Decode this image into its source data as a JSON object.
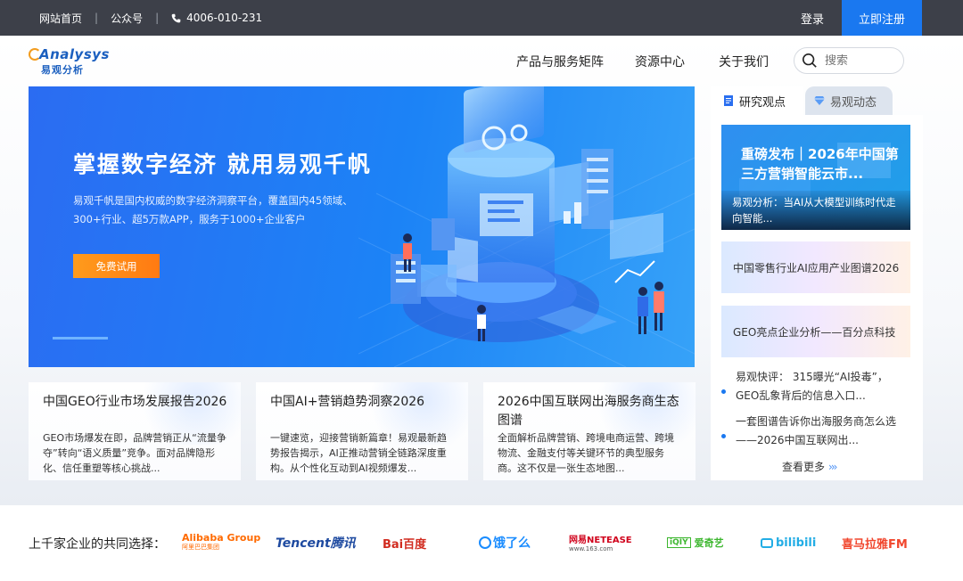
{
  "topbar": {
    "home": "网站首页",
    "wechat": "公众号",
    "phone": "4006-010-231",
    "login": "登录",
    "register": "立即注册"
  },
  "logo": {
    "en": "Analysys",
    "cn": "易观分析"
  },
  "nav": [
    {
      "label": "产品与服务矩阵"
    },
    {
      "label": "资源中心"
    },
    {
      "label": "关于我们"
    }
  ],
  "search": {
    "placeholder": "搜索"
  },
  "hero": {
    "title": "掌握数字经济  就用易观千帆",
    "desc": "易观千帆是国内权威的数字经济洞察平台，覆盖国内45领域、300+行业、超5万款APP，服务于1000+企业客户",
    "button": "免费试用"
  },
  "side": {
    "tabs": [
      {
        "label": "研究观点",
        "icon": "document-icon"
      },
      {
        "label": "易观动态",
        "icon": "diamond-icon"
      }
    ],
    "feature": {
      "headline": "重磅发布｜2026年中国第三方营销智能云市...",
      "caption": "易观分析：当AI从大模型训练时代走向智能..."
    },
    "cards": [
      {
        "title": "中国零售行业AI应用产业图谱2026"
      },
      {
        "title": "GEO亮点企业分析——百分点科技"
      }
    ],
    "news": [
      {
        "text": "易观快评： 315曝光“AI投毒”，GEO乱象背后的信息入口..."
      },
      {
        "text": "一套图谱告诉你出海服务商怎么选——2026中国互联网出..."
      }
    ],
    "more": "查看更多"
  },
  "reports": [
    {
      "title": "中国GEO行业市场发展报告2026",
      "desc": "GEO市场爆发在即，品牌营销正从“流量争夺”转向“语义质量”竞争。面对品牌隐形化、信任重塑等核心挑战..."
    },
    {
      "title": "中国AI+营销趋势洞察2026",
      "desc": "一键速览，迎接营销新篇章！易观最新趋势报告揭示，AI正推动营销全链路深度重构。从个性化互动到AI视频爆发..."
    },
    {
      "title": "2026中国互联网出海服务商生态图谱",
      "desc": "全面解析品牌营销、跨境电商运营、跨境物流、金融支付等关键环节的典型服务商。这不仅是一张生态地图..."
    }
  ],
  "partners": {
    "label": "上千家企业的共同选择：",
    "logos": [
      {
        "name": "Alibaba Group",
        "sub": "阿里巴巴集团",
        "color": "#ff6a00"
      },
      {
        "name": "Tencent腾讯",
        "color": "#1e4aa0"
      },
      {
        "name": "Bai百度",
        "color": "#d12b1f"
      },
      {
        "name": "饿了么",
        "color": "#1a8cff"
      },
      {
        "name": "网易NETEASE",
        "sub": "www.163.com",
        "color": "#d0021b"
      },
      {
        "name": "爱奇艺",
        "color": "#3cb62e"
      },
      {
        "name": "bilibili",
        "color": "#23ade5"
      },
      {
        "name": "喜马拉雅FM",
        "color": "#f1462d"
      }
    ]
  }
}
